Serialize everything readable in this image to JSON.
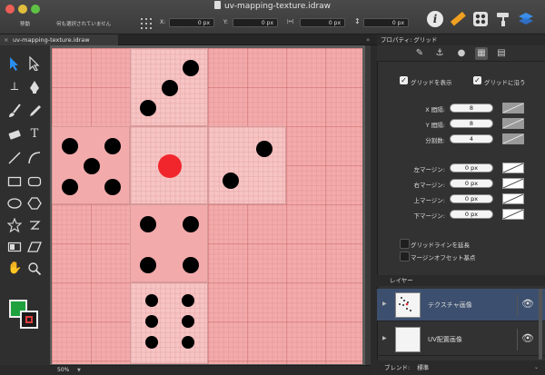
{
  "window": {
    "title": "uv-mapping-texture.idraw"
  },
  "toolbar": {
    "move_label": "移動",
    "selection_label": "何も選択されていません",
    "x_label": "X:",
    "x_value": "0 px",
    "y_label": "Y:",
    "y_value": "0 px",
    "w_value": "0 px",
    "h_value": "0 px"
  },
  "tab": {
    "label": "uv-mapping-texture.idraw"
  },
  "status": {
    "zoom": "50%"
  },
  "inspector": {
    "title": "プロパティ: グリッド",
    "show_grid_label": "グリッドを表示",
    "snap_grid_label": "グリッドに沿う",
    "x_spacing_label": "X 間隔:",
    "x_spacing": "8",
    "y_spacing_label": "Y 間隔:",
    "y_spacing": "8",
    "divisions_label": "分割数:",
    "divisions": "4",
    "margin_left_label": "左マージン:",
    "margin_left": "0 px",
    "margin_right_label": "右マージン:",
    "margin_right": "0 px",
    "margin_top_label": "上マージン:",
    "margin_top": "0 px",
    "margin_bottom_label": "下マージン:",
    "margin_bottom": "0 px",
    "extend_lines_label": "グリッドラインを延長",
    "margin_offset_label": "マージンオフセット基点"
  },
  "layers": {
    "title": "レイヤー",
    "items": [
      {
        "name": "テクスチャ画像"
      },
      {
        "name": "UV配置画像"
      }
    ],
    "blend_label": "ブレンド:",
    "blend_value": "標準"
  },
  "colors": {
    "accent": "#2a7be4",
    "canvas": "#f3aaab",
    "face": "#f7c4c4",
    "red_pip": "#f0262c",
    "selected_layer": "#3c4f6e"
  }
}
